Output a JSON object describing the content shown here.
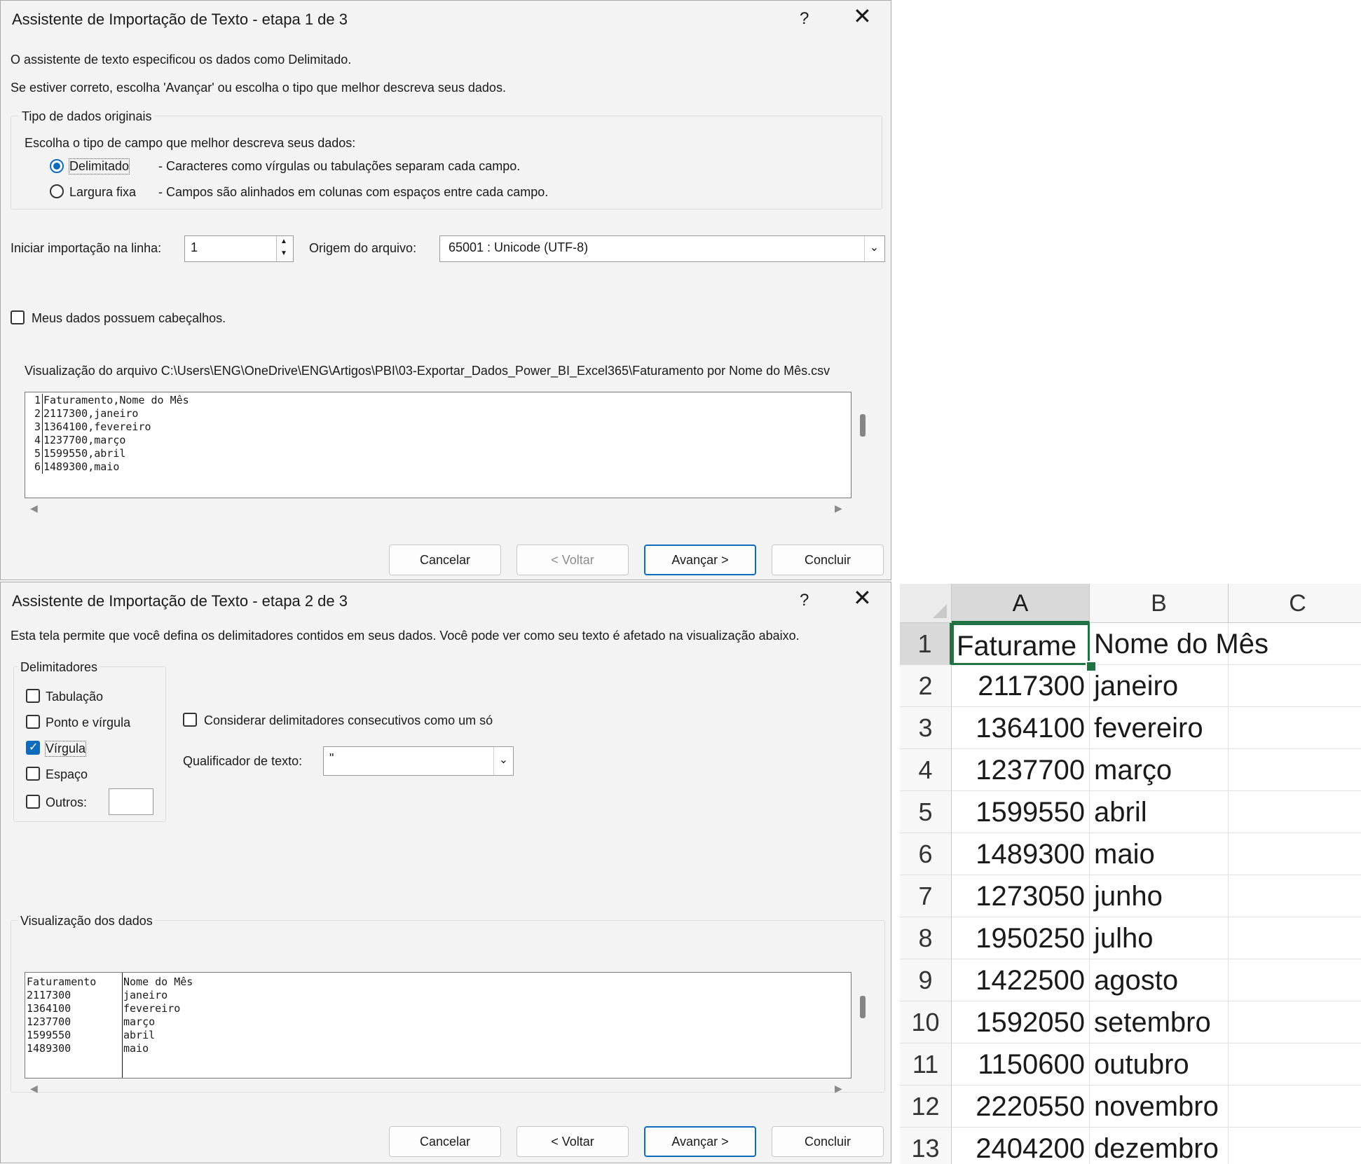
{
  "dialog1": {
    "title": "Assistente de Importação de Texto - etapa 1 de 3",
    "help": "?",
    "close": "✕",
    "line1": "O assistente de texto especificou os dados como Delimitado.",
    "line2": "Se estiver correto, escolha 'Avançar' ou escolha o tipo que melhor descreva seus dados.",
    "group_title": "Tipo de dados originais",
    "group_prompt": "Escolha o tipo de campo que melhor descreva seus dados:",
    "radio_delimited_label": "Delimitado",
    "radio_delimited_desc": "- Caracteres como vírgulas ou tabulações separam cada campo.",
    "radio_fixed_label": "Largura fixa",
    "radio_fixed_desc": "- Campos são alinhados em colunas com espaços entre cada campo.",
    "start_row_label": "Iniciar importação na linha:",
    "start_row_value": "1",
    "origin_label": "Origem do arquivo:",
    "origin_value": "65001 : Unicode (UTF-8)",
    "headers_label": "Meus dados possuem cabeçalhos.",
    "preview_label": "Visualização do arquivo C:\\Users\\ENG\\OneDrive\\ENG\\Artigos\\PBI\\03-Exportar_Dados_Power_BI_Excel365\\Faturamento por Nome do Mês.csv",
    "preview_lines": [
      {
        "n": "1",
        "text": "Faturamento,Nome do Mês"
      },
      {
        "n": "2",
        "text": "2117300,janeiro"
      },
      {
        "n": "3",
        "text": "1364100,fevereiro"
      },
      {
        "n": "4",
        "text": "1237700,março"
      },
      {
        "n": "5",
        "text": "1599550,abril"
      },
      {
        "n": "6",
        "text": "1489300,maio"
      }
    ],
    "buttons": {
      "cancel": "Cancelar",
      "back": "< Voltar",
      "next": "Avançar >",
      "finish": "Concluir"
    }
  },
  "dialog2": {
    "title": "Assistente de Importação de Texto - etapa 2 de 3",
    "help": "?",
    "close": "✕",
    "line1": "Esta tela permite que você defina os delimitadores contidos em seus dados. Você pode ver como seu texto é afetado na visualização abaixo.",
    "delims_title": "Delimitadores",
    "delim_tab": "Tabulação",
    "delim_semicolon": "Ponto e vírgula",
    "delim_comma": "Vírgula",
    "delim_space": "Espaço",
    "delim_other": "Outros:",
    "consecutive_label": "Considerar delimitadores consecutivos como um só",
    "qualifier_label": "Qualificador de texto:",
    "qualifier_value": "\"",
    "preview_title": "Visualização dos dados",
    "preview_rows": [
      {
        "a": "Faturamento",
        "b": "Nome do Mês"
      },
      {
        "a": "2117300",
        "b": "janeiro"
      },
      {
        "a": "1364100",
        "b": "fevereiro"
      },
      {
        "a": "1237700",
        "b": "março"
      },
      {
        "a": "1599550",
        "b": "abril"
      },
      {
        "a": "1489300",
        "b": "maio"
      }
    ],
    "buttons": {
      "cancel": "Cancelar",
      "back": "< Voltar",
      "next": "Avançar >",
      "finish": "Concluir"
    }
  },
  "sheet": {
    "columns": [
      "A",
      "B",
      "C"
    ],
    "rows": [
      {
        "n": "1",
        "a": "Faturame",
        "b": "Nome do Mês"
      },
      {
        "n": "2",
        "a": "2117300",
        "b": "janeiro"
      },
      {
        "n": "3",
        "a": "1364100",
        "b": "fevereiro"
      },
      {
        "n": "4",
        "a": "1237700",
        "b": "março"
      },
      {
        "n": "5",
        "a": "1599550",
        "b": "abril"
      },
      {
        "n": "6",
        "a": "1489300",
        "b": "maio"
      },
      {
        "n": "7",
        "a": "1273050",
        "b": "junho"
      },
      {
        "n": "8",
        "a": "1950250",
        "b": "julho"
      },
      {
        "n": "9",
        "a": "1422500",
        "b": "agosto"
      },
      {
        "n": "10",
        "a": "1592050",
        "b": "setembro"
      },
      {
        "n": "11",
        "a": "1150600",
        "b": "outubro"
      },
      {
        "n": "12",
        "a": "2220550",
        "b": "novembro"
      },
      {
        "n": "13",
        "a": "2404200",
        "b": "dezembro"
      }
    ]
  }
}
